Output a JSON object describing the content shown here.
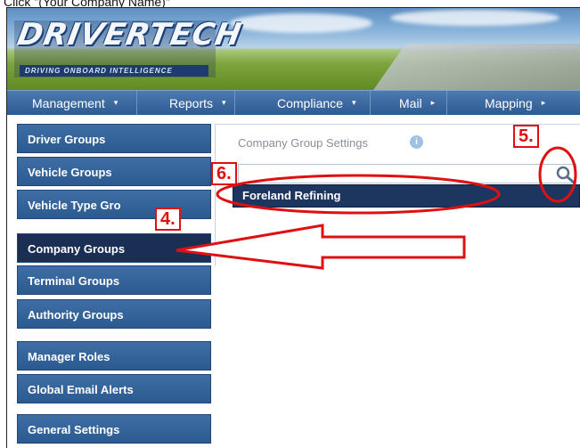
{
  "caption": "Click \"(Your Company Name)\"",
  "brand": {
    "logo_text": "DRIVERTECH",
    "tagline": "DRIVING ONBOARD INTELLIGENCE"
  },
  "nav": {
    "items": [
      {
        "label": "Management",
        "caret": "▾"
      },
      {
        "label": "Reports",
        "caret": "▾"
      },
      {
        "label": "Compliance",
        "caret": "▾"
      },
      {
        "label": "Mail",
        "caret": "▸"
      },
      {
        "label": "Mapping",
        "caret": "▸"
      }
    ]
  },
  "sidebar": {
    "items": [
      {
        "label": "Driver Groups"
      },
      {
        "label": "Vehicle Groups"
      },
      {
        "label": "Vehicle Type Gro"
      },
      {
        "label": "Company Groups"
      },
      {
        "label": "Terminal Groups"
      },
      {
        "label": "Authority Groups"
      },
      {
        "label": "Manager Roles"
      },
      {
        "label": "Global Email Alerts"
      },
      {
        "label": "General Settings"
      }
    ]
  },
  "panel": {
    "title": "Company Group Settings",
    "info_glyph": "i",
    "search_value": "",
    "result": "Foreland Refining"
  },
  "annotations": {
    "step4": "4.",
    "step5": "5.",
    "step6": "6.",
    "color": "#e01010"
  },
  "colors": {
    "nav_bg": "#2c5a92",
    "sidebar_bg": "#2b5a91",
    "sidebar_active": "#1b2f55",
    "dropdown_bg": "#1c3660"
  }
}
